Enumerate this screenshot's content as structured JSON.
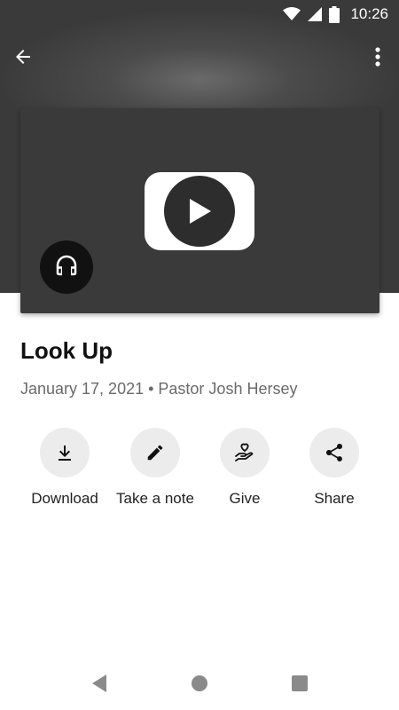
{
  "status_bar": {
    "time": "10:26",
    "icons": [
      "wifi-icon",
      "cell-signal-icon",
      "battery-icon"
    ]
  },
  "top_bar": {
    "back_icon": "arrow-back-icon",
    "menu_icon": "more-vert-icon"
  },
  "media": {
    "play_icon": "play-icon",
    "audio_icon": "headphones-icon"
  },
  "sermon": {
    "title": "Look Up",
    "meta": "January 17, 2021 • Pastor Josh Hersey"
  },
  "actions": [
    {
      "label": "Download",
      "icon": "download-icon"
    },
    {
      "label": "Take a note",
      "icon": "pencil-icon"
    },
    {
      "label": "Give",
      "icon": "give-heart-hand-icon"
    },
    {
      "label": "Share",
      "icon": "share-icon"
    }
  ],
  "nav_bar": {
    "icons": [
      "nav-back-icon",
      "nav-home-icon",
      "nav-recents-icon"
    ]
  },
  "colors": {
    "hero_background": "#3a3a3a",
    "action_circle": "#ececec",
    "meta_text": "#6a6a6a"
  }
}
